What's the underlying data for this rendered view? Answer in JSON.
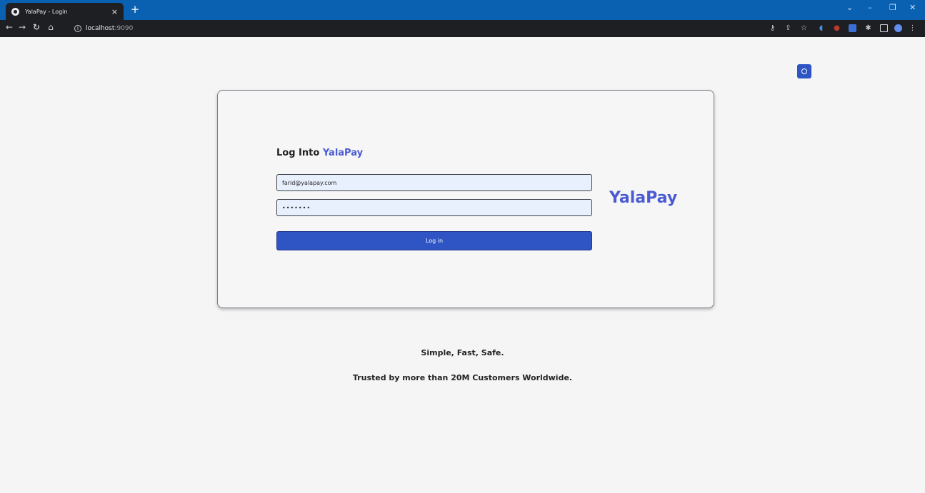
{
  "browser": {
    "tab_title": "YalaPay - Login",
    "tab_close": "×",
    "new_tab": "+",
    "url_host": "localhost",
    "url_port": ":9090",
    "win_controls": [
      "⌄",
      "–",
      "❐",
      "✕"
    ]
  },
  "page": {
    "heading_prefix": "Log Into",
    "heading_brand": "YalaPay",
    "email_value": "farid@yalapay.com",
    "password_value": "•••••••",
    "login_button": "Log in",
    "side_logo": "YalaPay",
    "tagline_1": "Simple, Fast, Safe.",
    "tagline_2": "Trusted by more than 20M Customers Worldwide."
  },
  "colors": {
    "brand": "#4a5bd3",
    "button": "#2e55c3",
    "tabbar": "#0a61b1"
  },
  "icons": [
    "back-icon",
    "forward-icon",
    "reload-icon",
    "home-icon",
    "info-icon",
    "key-icon",
    "share-icon",
    "star-icon",
    "extensions-icon",
    "sidepanel-icon",
    "profile-icon",
    "menu-icon",
    "theme-toggle-icon"
  ]
}
